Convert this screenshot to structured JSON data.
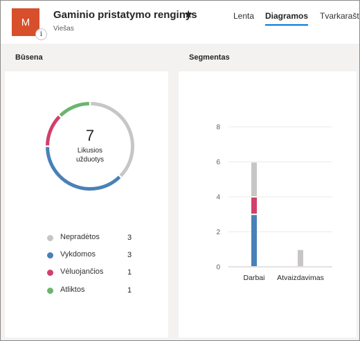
{
  "header": {
    "avatar_letter": "M",
    "avatar_color": "#d74f2b",
    "info_glyph": "i",
    "title": "Gaminio pristatymo renginys",
    "star_icon": "star-icon",
    "star_glyph": "★",
    "visibility": "Viešas",
    "tabs": [
      {
        "label": "Lenta",
        "active": false
      },
      {
        "label": "Diagramos",
        "active": true
      },
      {
        "label": "Tvarkaraštis",
        "active": false
      }
    ],
    "accent_color": "#0078d4"
  },
  "status_card": {
    "title": "Būsena",
    "remaining_count": "7",
    "remaining_caption_line1": "Likusios",
    "remaining_caption_line2": "užduotys",
    "legend": [
      {
        "label": "Nepradėtos",
        "count": "3",
        "color": "#c8c6c4"
      },
      {
        "label": "Vykdomos",
        "count": "3",
        "color": "#4a80b8"
      },
      {
        "label": "Vėluojančios",
        "count": "1",
        "color": "#d13f6a"
      },
      {
        "label": "Atliktos",
        "count": "1",
        "color": "#6bb56d"
      }
    ]
  },
  "segment_card": {
    "title": "Segmentas"
  },
  "chart_data": {
    "type": "bar",
    "stacked": true,
    "categories": [
      "Darbai",
      "Atvaizdavimas"
    ],
    "series": [
      {
        "name": "Vykdomos",
        "values": [
          3,
          0
        ],
        "color": "#4a80b8"
      },
      {
        "name": "Vėluojančios",
        "values": [
          1,
          0
        ],
        "color": "#d13f6a"
      },
      {
        "name": "Nepradėtos",
        "values": [
          2,
          1
        ],
        "color": "#c8c6c4"
      }
    ],
    "yticks": [
      "0",
      "2",
      "4",
      "6",
      "8"
    ],
    "ylim": [
      0,
      8
    ],
    "grid": true
  }
}
